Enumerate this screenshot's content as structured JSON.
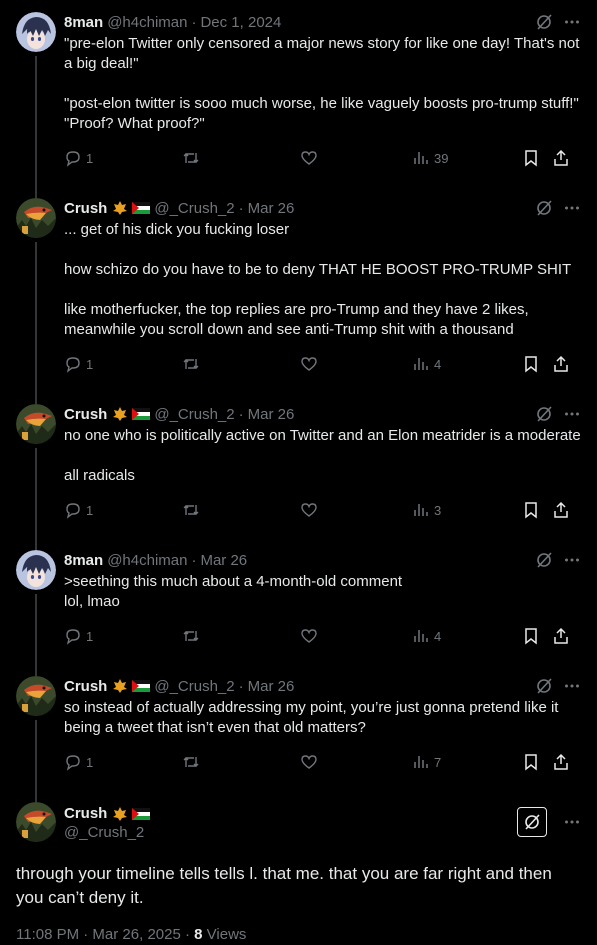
{
  "tweets": [
    {
      "name": "8man",
      "handle": "@h4chiman",
      "date": "Dec 1, 2024",
      "text": "\"pre-elon Twitter only censored a major news story for like one day! That's not a big deal!\"\n\n\"post-elon twitter is sooo much worse, he like vaguely boosts pro-trump stuff!\"\n\"Proof? What proof?\"",
      "replies": "1",
      "views": "39",
      "avatar": "anime-avatar"
    },
    {
      "name": "Crush",
      "handle": "@_Crush_2",
      "date": "Mar 26",
      "text": "... get of his dick you fucking loser\n\nhow schizo do you have to be to deny THAT HE BOOST PRO-TRUMP SHIT\n\nlike motherfucker, the top replies are pro-Trump and they have 2 likes, meanwhile you scroll down and see anti-Trump shit with a thousand",
      "replies": "1",
      "views": "4",
      "avatar": "bird-avatar"
    },
    {
      "name": "Crush",
      "handle": "@_Crush_2",
      "date": "Mar 26",
      "text": "no one who is politically active on Twitter and an Elon meatrider is a moderate\n\nall radicals",
      "replies": "1",
      "views": "3",
      "avatar": "bird-avatar"
    },
    {
      "name": "8man",
      "handle": "@h4chiman",
      "date": "Mar 26",
      "text": ">seething this much about a 4-month-old comment\nlol, lmao",
      "replies": "1",
      "views": "4",
      "avatar": "anime-avatar"
    },
    {
      "name": "Crush",
      "handle": "@_Crush_2",
      "date": "Mar 26",
      "text": "so instead of actually addressing my point, you’re just gonna pretend like it being a tweet that isn’t even that old matters?",
      "replies": "1",
      "views": "7",
      "avatar": "bird-avatar"
    }
  ],
  "main": {
    "name": "Crush",
    "handle": "@_Crush_2",
    "text": "through your timeline tells tells l. that me. that you are far right and then you can’t deny it.",
    "time": "11:08 PM · Mar 26, 2025",
    "sep": " · ",
    "views_count": "8",
    "views_label": "Views"
  },
  "separators": {
    "dot": "·"
  },
  "colors": {
    "background": "#000000",
    "text": "#e7e9ea",
    "muted": "#71767b",
    "thread_line": "#333639"
  }
}
